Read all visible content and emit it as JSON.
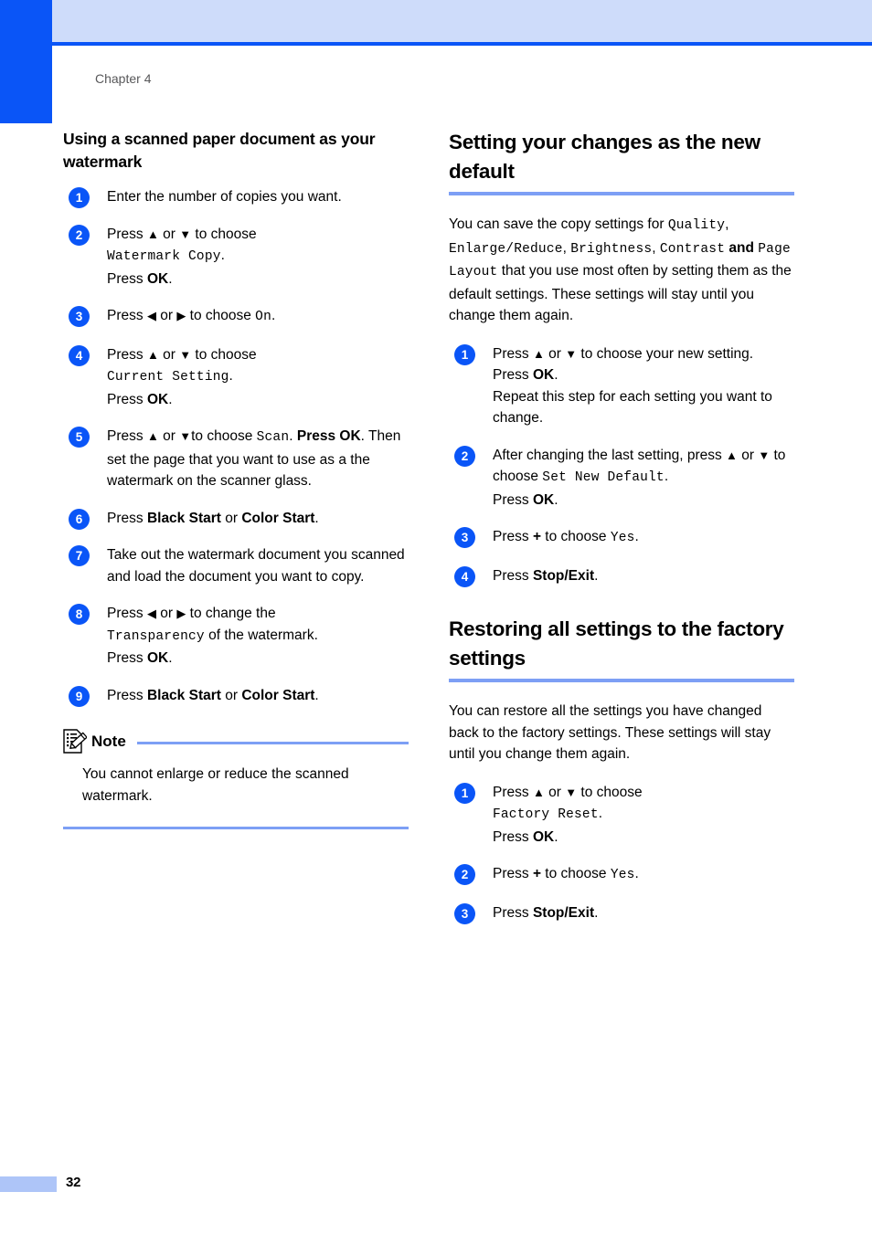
{
  "page": {
    "chapter_label": "Chapter 4",
    "page_number": "32",
    "accent_blue": "#0a55f7",
    "band_blue": "#cedcfa",
    "rule_blue": "#7d9ff5",
    "footer_tab_blue": "#aec5f8"
  },
  "left_column": {
    "subheading": "Using a scanned paper document as your watermark",
    "steps": [
      {
        "num": "1",
        "lines": [
          [
            {
              "t": "Enter the number of copies you want.",
              "s": "n"
            }
          ]
        ]
      },
      {
        "num": "2",
        "lines": [
          [
            {
              "t": "Press ",
              "s": "n"
            },
            {
              "t": "▲",
              "s": "a"
            },
            {
              "t": " or ",
              "s": "n"
            },
            {
              "t": "▼",
              "s": "a"
            },
            {
              "t": " to choose",
              "s": "n"
            }
          ],
          [
            {
              "t": "Watermark Copy",
              "s": "m"
            },
            {
              "t": ".",
              "s": "n"
            }
          ],
          [
            {
              "t": "Press ",
              "s": "n"
            },
            {
              "t": "OK",
              "s": "b"
            },
            {
              "t": ".",
              "s": "n"
            }
          ]
        ]
      },
      {
        "num": "3",
        "lines": [
          [
            {
              "t": "Press ",
              "s": "n"
            },
            {
              "t": "◀",
              "s": "a"
            },
            {
              "t": " or ",
              "s": "n"
            },
            {
              "t": "▶",
              "s": "a"
            },
            {
              "t": " to choose ",
              "s": "n"
            },
            {
              "t": "On",
              "s": "m"
            },
            {
              "t": ".",
              "s": "n"
            }
          ]
        ]
      },
      {
        "num": "4",
        "lines": [
          [
            {
              "t": "Press ",
              "s": "n"
            },
            {
              "t": "▲",
              "s": "a"
            },
            {
              "t": " or ",
              "s": "n"
            },
            {
              "t": "▼",
              "s": "a"
            },
            {
              "t": " to choose",
              "s": "n"
            }
          ],
          [
            {
              "t": "Current Setting",
              "s": "m"
            },
            {
              "t": ".",
              "s": "n"
            }
          ],
          [
            {
              "t": "Press ",
              "s": "n"
            },
            {
              "t": "OK",
              "s": "b"
            },
            {
              "t": ".",
              "s": "n"
            }
          ]
        ]
      },
      {
        "num": "5",
        "lines": [
          [
            {
              "t": "Press ",
              "s": "n"
            },
            {
              "t": "▲",
              "s": "a"
            },
            {
              "t": " or ",
              "s": "n"
            },
            {
              "t": "▼",
              "s": "a"
            },
            {
              "t": "to choose ",
              "s": "n"
            },
            {
              "t": "Scan",
              "s": "m"
            },
            {
              "t": ". ",
              "s": "n"
            },
            {
              "t": "Press ",
              "s": "b"
            },
            {
              "t": "OK",
              "s": "b"
            },
            {
              "t": ".",
              "s": "n"
            },
            {
              "t": " Then set the page that you want to use as a the watermark on the scanner glass.",
              "s": "n"
            }
          ]
        ]
      },
      {
        "num": "6",
        "lines": [
          [
            {
              "t": "Press ",
              "s": "n"
            },
            {
              "t": "Black Start",
              "s": "b"
            },
            {
              "t": " or ",
              "s": "n"
            },
            {
              "t": "Color Start",
              "s": "b"
            },
            {
              "t": ".",
              "s": "n"
            }
          ]
        ]
      },
      {
        "num": "7",
        "lines": [
          [
            {
              "t": "Take out the watermark document you scanned and load the document you want to copy.",
              "s": "n"
            }
          ]
        ]
      },
      {
        "num": "8",
        "lines": [
          [
            {
              "t": "Press ",
              "s": "n"
            },
            {
              "t": "◀",
              "s": "a"
            },
            {
              "t": " or ",
              "s": "n"
            },
            {
              "t": "▶",
              "s": "a"
            },
            {
              "t": " to change the",
              "s": "n"
            }
          ],
          [
            {
              "t": "Transparency",
              "s": "m"
            },
            {
              "t": " of the watermark.",
              "s": "n"
            }
          ],
          [
            {
              "t": "Press ",
              "s": "n"
            },
            {
              "t": "OK",
              "s": "b"
            },
            {
              "t": ".",
              "s": "n"
            }
          ]
        ]
      },
      {
        "num": "9",
        "lines": [
          [
            {
              "t": "Press ",
              "s": "n"
            },
            {
              "t": "Black Start",
              "s": "b"
            },
            {
              "t": " or ",
              "s": "n"
            },
            {
              "t": "Color Start",
              "s": "b"
            },
            {
              "t": ".",
              "s": "n"
            }
          ]
        ]
      }
    ],
    "note": {
      "title": "Note",
      "body": "You cannot enlarge or reduce the scanned watermark."
    }
  },
  "right_column": {
    "section_1": {
      "heading": "Setting your changes as the new default",
      "intro": [
        {
          "t": "You can save the copy settings for ",
          "s": "n"
        },
        {
          "t": "Quality",
          "s": "m"
        },
        {
          "t": ", ",
          "s": "n"
        },
        {
          "t": "Enlarge/Reduce",
          "s": "m"
        },
        {
          "t": ", ",
          "s": "n"
        },
        {
          "t": "Brightness",
          "s": "m"
        },
        {
          "t": ", ",
          "s": "n"
        },
        {
          "t": "Contrast",
          "s": "m"
        },
        {
          "t": " and ",
          "s": "b"
        },
        {
          "t": "Page Layout",
          "s": "m"
        },
        {
          "t": " that you use most often by setting them as the default settings. These settings will stay until you change them again.",
          "s": "n"
        }
      ],
      "steps": [
        {
          "num": "1",
          "lines": [
            [
              {
                "t": "Press ",
                "s": "n"
              },
              {
                "t": "▲",
                "s": "a"
              },
              {
                "t": " or ",
                "s": "n"
              },
              {
                "t": "▼",
                "s": "a"
              },
              {
                "t": " to choose your new setting.",
                "s": "n"
              }
            ],
            [
              {
                "t": "Press ",
                "s": "n"
              },
              {
                "t": "OK",
                "s": "b"
              },
              {
                "t": ".",
                "s": "n"
              }
            ],
            [
              {
                "t": "Repeat this step for each setting you want to change.",
                "s": "n"
              }
            ]
          ]
        },
        {
          "num": "2",
          "lines": [
            [
              {
                "t": "After changing the last setting, press ",
                "s": "n"
              },
              {
                "t": "▲",
                "s": "a"
              },
              {
                "t": " or ",
                "s": "n"
              },
              {
                "t": "▼",
                "s": "a"
              },
              {
                "t": " to choose ",
                "s": "n"
              },
              {
                "t": "Set New Default",
                "s": "m"
              },
              {
                "t": ".",
                "s": "n"
              }
            ],
            [
              {
                "t": "Press ",
                "s": "n"
              },
              {
                "t": "OK",
                "s": "b"
              },
              {
                "t": ".",
                "s": "n"
              }
            ]
          ]
        },
        {
          "num": "3",
          "lines": [
            [
              {
                "t": "Press ",
                "s": "n"
              },
              {
                "t": "+",
                "s": "b"
              },
              {
                "t": " to choose ",
                "s": "n"
              },
              {
                "t": "Yes",
                "s": "m"
              },
              {
                "t": ".",
                "s": "n"
              }
            ]
          ]
        },
        {
          "num": "4",
          "lines": [
            [
              {
                "t": "Press ",
                "s": "n"
              },
              {
                "t": "Stop/Exit",
                "s": "b"
              },
              {
                "t": ".",
                "s": "n"
              }
            ]
          ]
        }
      ]
    },
    "section_2": {
      "heading": "Restoring all settings to the factory settings",
      "intro": [
        {
          "t": "You can restore all the settings you have changed back to the factory settings. These settings will stay until you change them again.",
          "s": "n"
        }
      ],
      "steps": [
        {
          "num": "1",
          "lines": [
            [
              {
                "t": "Press ",
                "s": "n"
              },
              {
                "t": "▲",
                "s": "a"
              },
              {
                "t": " or ",
                "s": "n"
              },
              {
                "t": "▼",
                "s": "a"
              },
              {
                "t": " to choose",
                "s": "n"
              }
            ],
            [
              {
                "t": "Factory Reset",
                "s": "m"
              },
              {
                "t": ".",
                "s": "n"
              }
            ],
            [
              {
                "t": "Press ",
                "s": "n"
              },
              {
                "t": "OK",
                "s": "b"
              },
              {
                "t": ".",
                "s": "n"
              }
            ]
          ]
        },
        {
          "num": "2",
          "lines": [
            [
              {
                "t": "Press ",
                "s": "n"
              },
              {
                "t": "+",
                "s": "b"
              },
              {
                "t": " to choose ",
                "s": "n"
              },
              {
                "t": "Yes",
                "s": "m"
              },
              {
                "t": ".",
                "s": "n"
              }
            ]
          ]
        },
        {
          "num": "3",
          "lines": [
            [
              {
                "t": "Press ",
                "s": "n"
              },
              {
                "t": "Stop/Exit",
                "s": "b"
              },
              {
                "t": ".",
                "s": "n"
              }
            ]
          ]
        }
      ]
    }
  }
}
